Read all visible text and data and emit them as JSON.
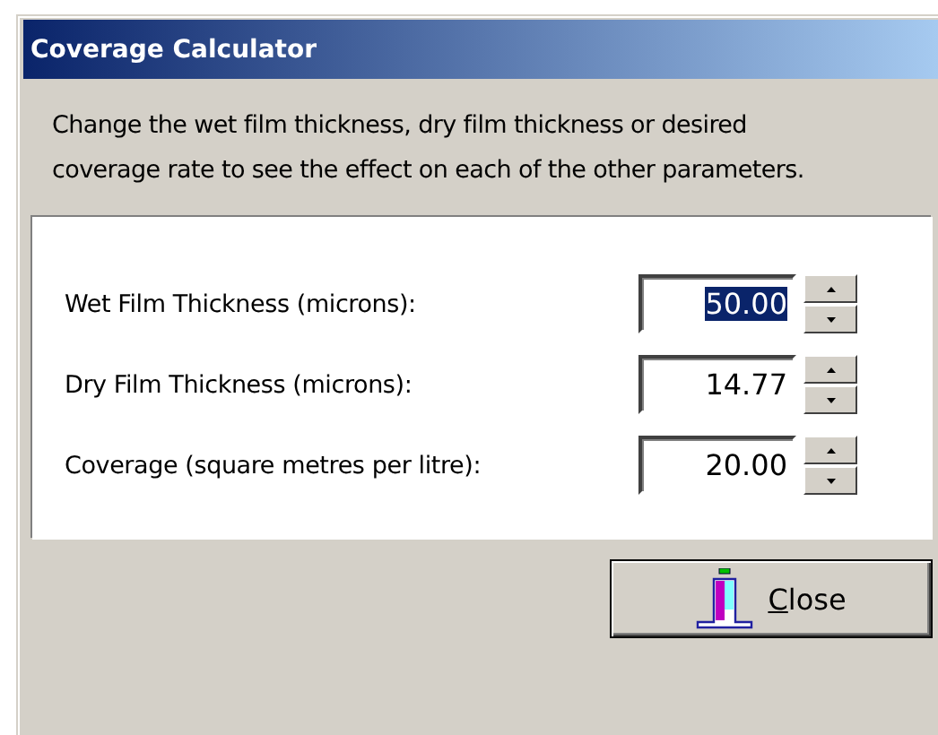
{
  "window": {
    "title": "Coverage Calculator"
  },
  "description": "Change the wet film thickness, dry film thickness or desired coverage rate to see the effect on each of the other parameters.",
  "fields": [
    {
      "label": "Wet Film Thickness (microns):",
      "value": "50.00",
      "selected": true
    },
    {
      "label": "Dry Film Thickness (microns):",
      "value": "14.77",
      "selected": false
    },
    {
      "label": "Coverage (square metres per litre):",
      "value": "20.00",
      "selected": false
    }
  ],
  "close_button": {
    "mnemonic_letter": "C",
    "rest": "lose"
  }
}
